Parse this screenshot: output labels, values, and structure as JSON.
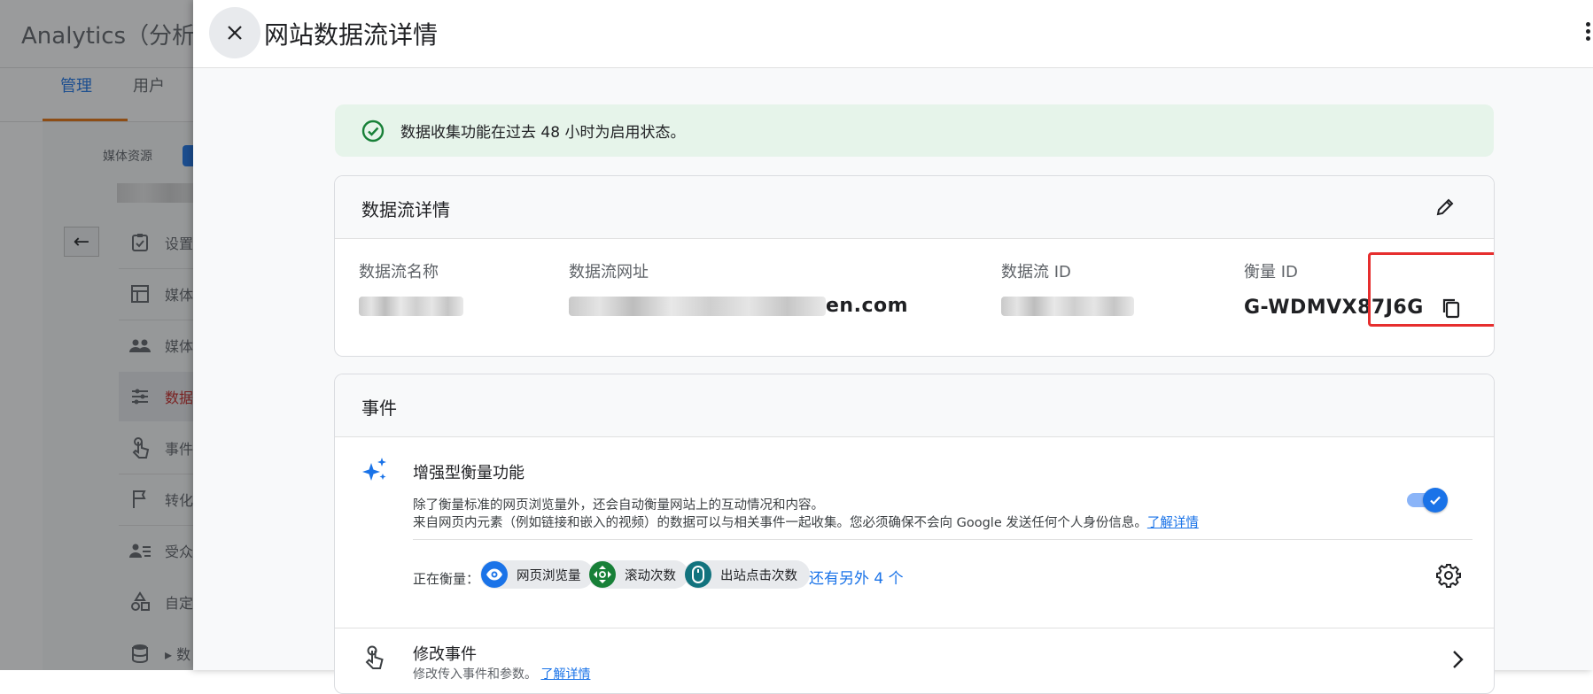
{
  "background": {
    "app_title": "Analytics（分析",
    "tabs": [
      {
        "label": "管理",
        "active": true
      },
      {
        "label": "用户",
        "active": false
      }
    ],
    "property_label": "媒体资源",
    "nav_items": [
      {
        "label": "设置",
        "icon": "settings-check-icon",
        "active": false
      },
      {
        "label": "媒体",
        "icon": "layout-icon",
        "active": false
      },
      {
        "label": "媒体",
        "icon": "people-icon",
        "active": false
      },
      {
        "label": "数据",
        "icon": "data-streams-icon",
        "active": true
      },
      {
        "label": "事件",
        "icon": "touch-icon",
        "active": false
      },
      {
        "label": "转化",
        "icon": "flag-icon",
        "active": false
      },
      {
        "label": "受众",
        "icon": "audience-icon",
        "active": false
      },
      {
        "label": "自定",
        "icon": "shapes-icon",
        "active": false
      },
      {
        "label": "数",
        "icon": "database-icon",
        "active": false
      }
    ]
  },
  "drawer": {
    "title": "网站数据流详情",
    "banner": {
      "text": "数据收集功能在过去 48 小时为启用状态。",
      "icon": "check-circle-icon",
      "bg_color": "#e6f4ea",
      "icon_color": "#188038"
    },
    "stream_card": {
      "title": "数据流详情",
      "fields": [
        {
          "label": "数据流名称",
          "value": ""
        },
        {
          "label": "数据流网址",
          "value": "en.com"
        },
        {
          "label": "数据流 ID",
          "value": ""
        },
        {
          "label": "衡量 ID",
          "value": "G-WDMVX87J6G"
        }
      ],
      "highlight_color": "#e62e2e"
    },
    "events_card": {
      "title": "事件",
      "enhanced": {
        "title": "增强型衡量功能",
        "desc_line1": "除了衡量标准的网页浏览量外，还会自动衡量网站上的互动情况和内容。",
        "desc_line2": "来自网页内元素（例如链接和嵌入的视频）的数据可以与相关事件一起收集。您必须确保不会向 Google 发送任何个人身份信息。",
        "learn_more": "了解详情",
        "enabled": true
      },
      "measuring_label": "正在衡量：",
      "chips": [
        {
          "label": "网页浏览量",
          "icon": "eye-icon",
          "color": "#1a73e8"
        },
        {
          "label": "滚动次数",
          "icon": "scroll-icon",
          "color": "#188038"
        },
        {
          "label": "出站点击次数",
          "icon": "mouse-icon",
          "color": "#12737e"
        }
      ],
      "more_link": "还有另外 4 个",
      "modify": {
        "title": "修改事件",
        "desc": "修改传入事件和参数。",
        "learn_more": "了解详情"
      }
    },
    "accent_color": "#1a73e8"
  }
}
